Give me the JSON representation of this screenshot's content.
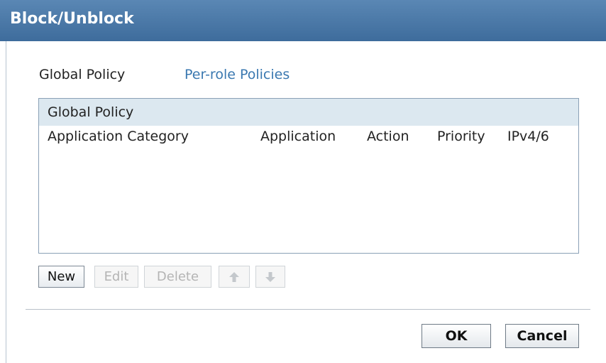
{
  "dialog": {
    "title": "Block/Unblock"
  },
  "tabs": [
    {
      "label": "Global Policy",
      "active": true
    },
    {
      "label": "Per-role Policies",
      "active": false
    }
  ],
  "table": {
    "caption": "Global Policy",
    "columns": [
      "Application Category",
      "Application",
      "Action",
      "Priority",
      "IPv4/6"
    ],
    "rows": []
  },
  "toolbar": {
    "new_label": "New",
    "edit_label": "Edit",
    "delete_label": "Delete",
    "move_up_icon": "arrow-up-icon",
    "move_down_icon": "arrow-down-icon"
  },
  "footer": {
    "ok_label": "OK",
    "cancel_label": "Cancel"
  },
  "colors": {
    "titlebar": "#4a79a9",
    "link": "#3a78b0",
    "caption_bg": "#dce8f0",
    "disabled_text": "#b4b4b4"
  }
}
